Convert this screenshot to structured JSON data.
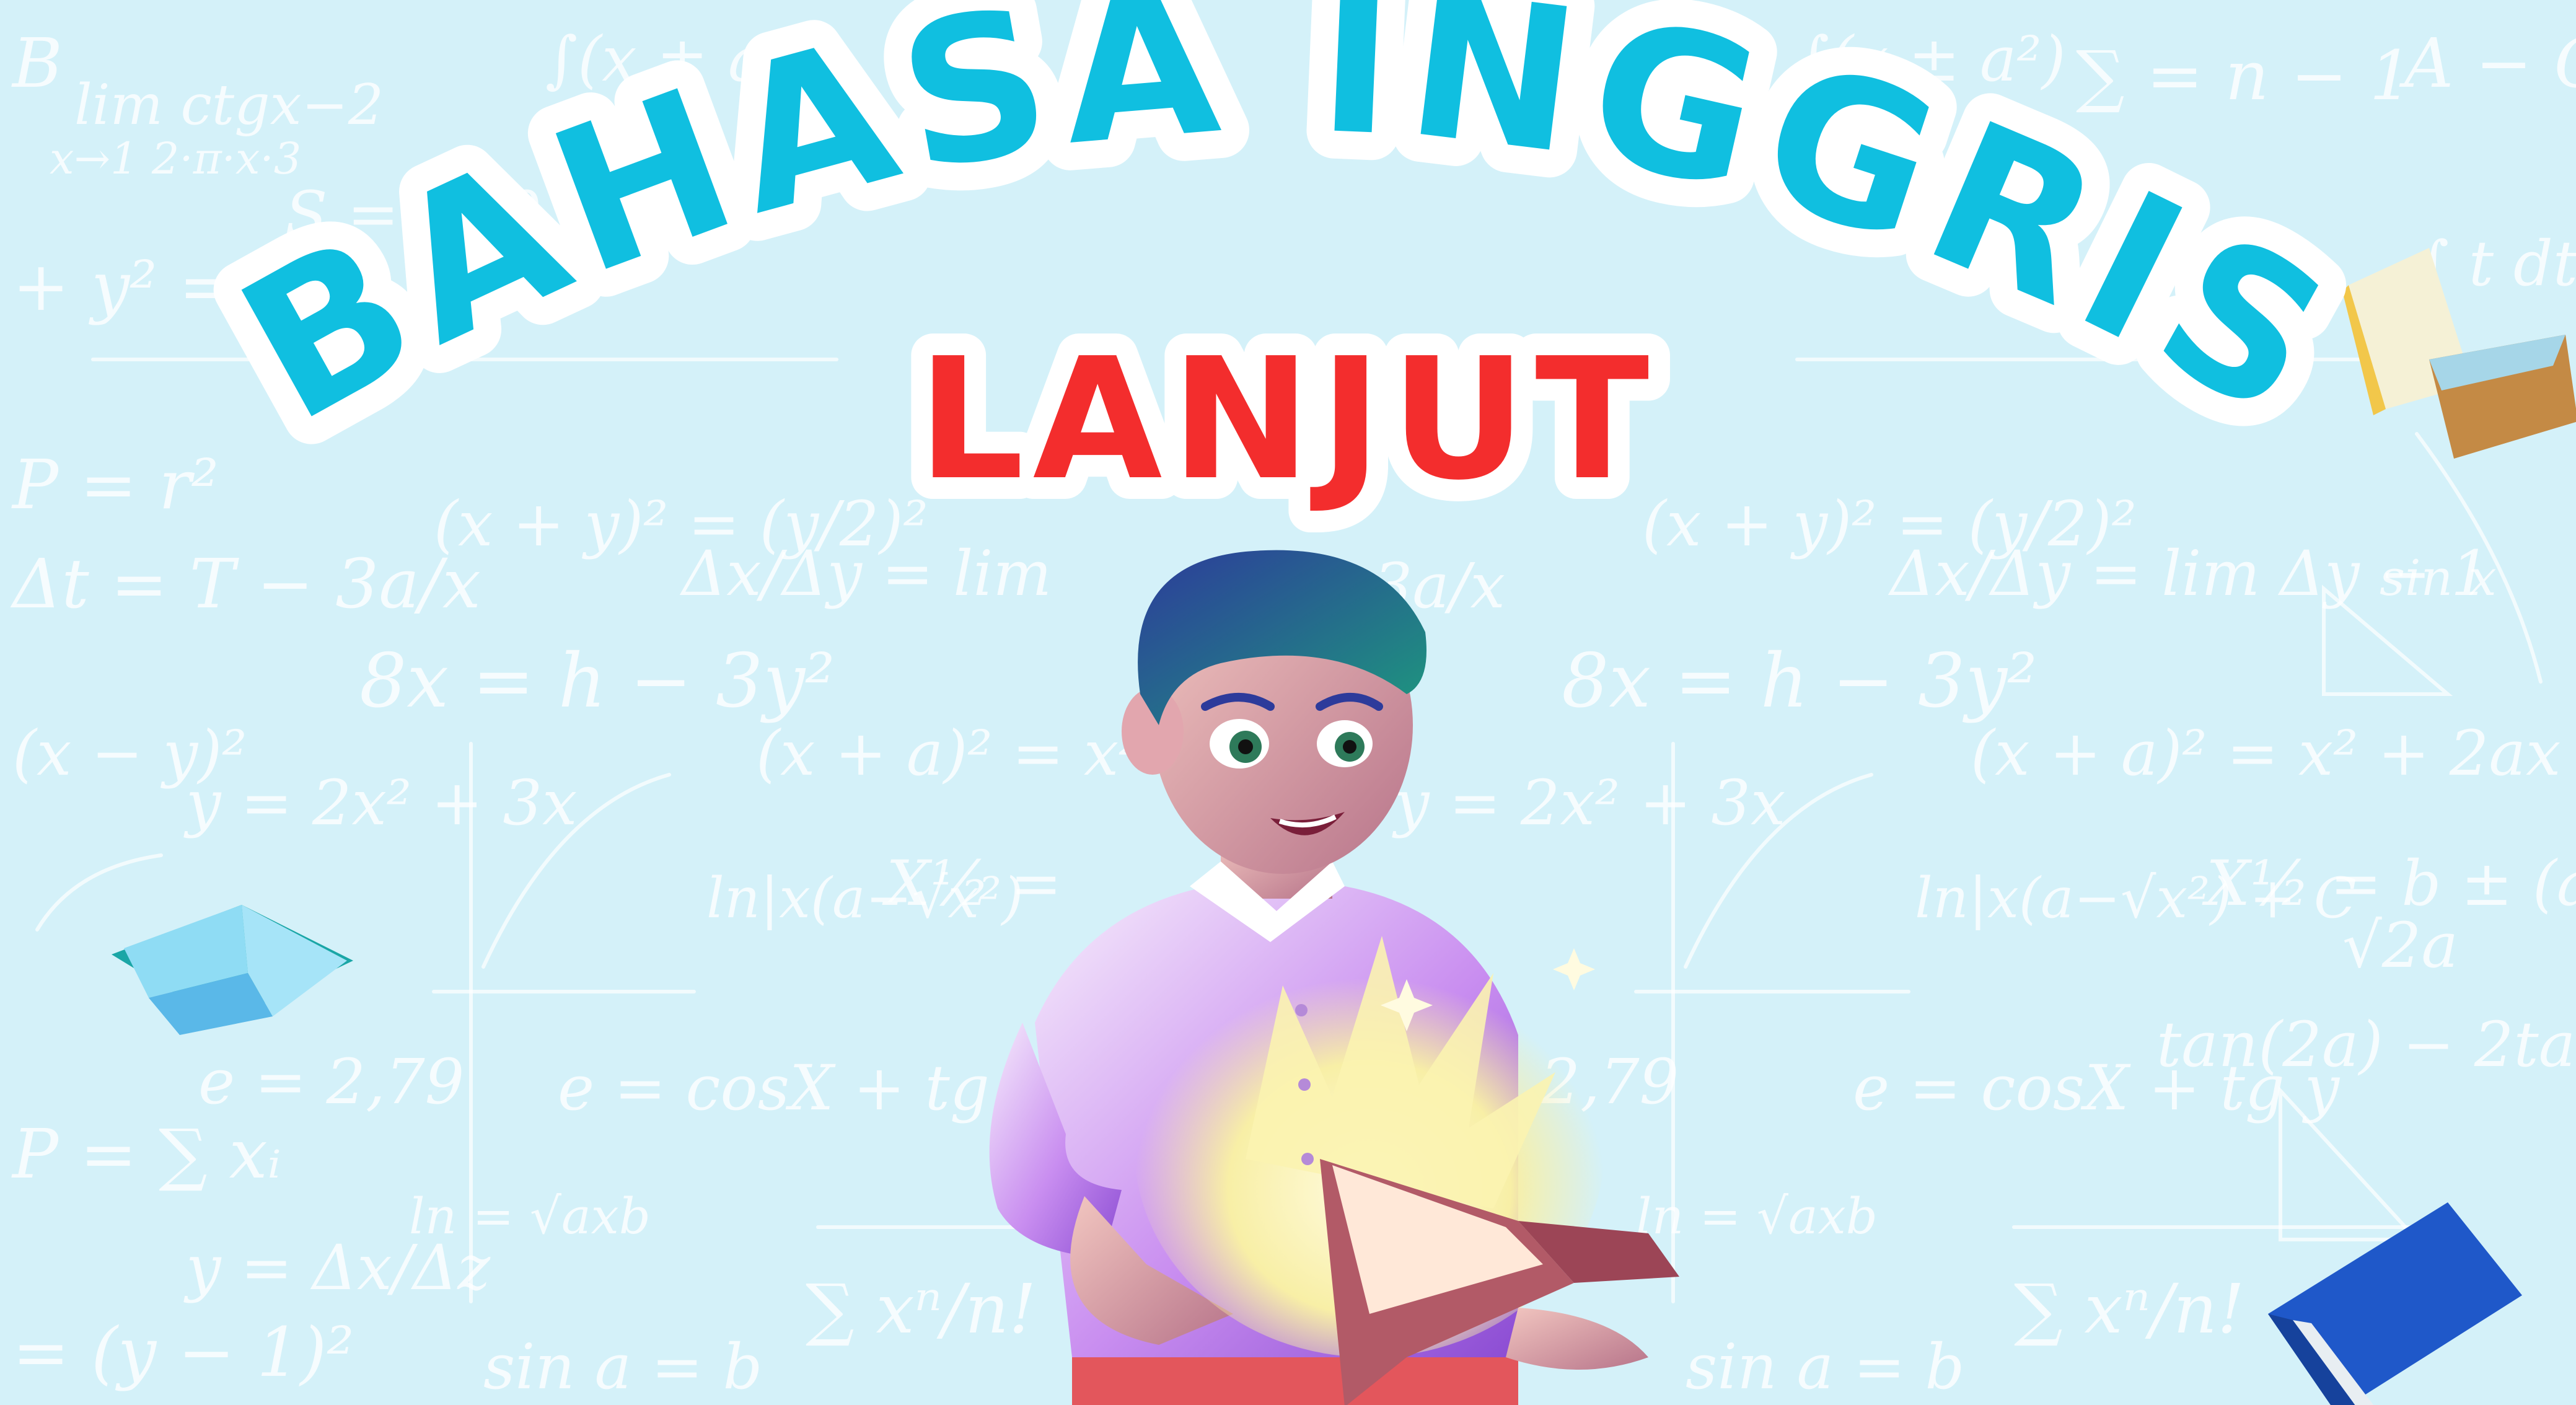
{
  "banner": {
    "title_line1": "BAHASA INGGRIS",
    "title_line2": "LANJUT"
  },
  "colors": {
    "background": "#d4f1f9",
    "title_primary": "#10bfe0",
    "title_secondary": "#f32d2d",
    "outline": "#ffffff",
    "chalk": "#ffffff"
  },
  "icons": {
    "book_left": "book-icon",
    "book_top_right": "book-icon",
    "book_bottom_right": "book-icon",
    "sparkle": "sparkle-icon"
  }
}
